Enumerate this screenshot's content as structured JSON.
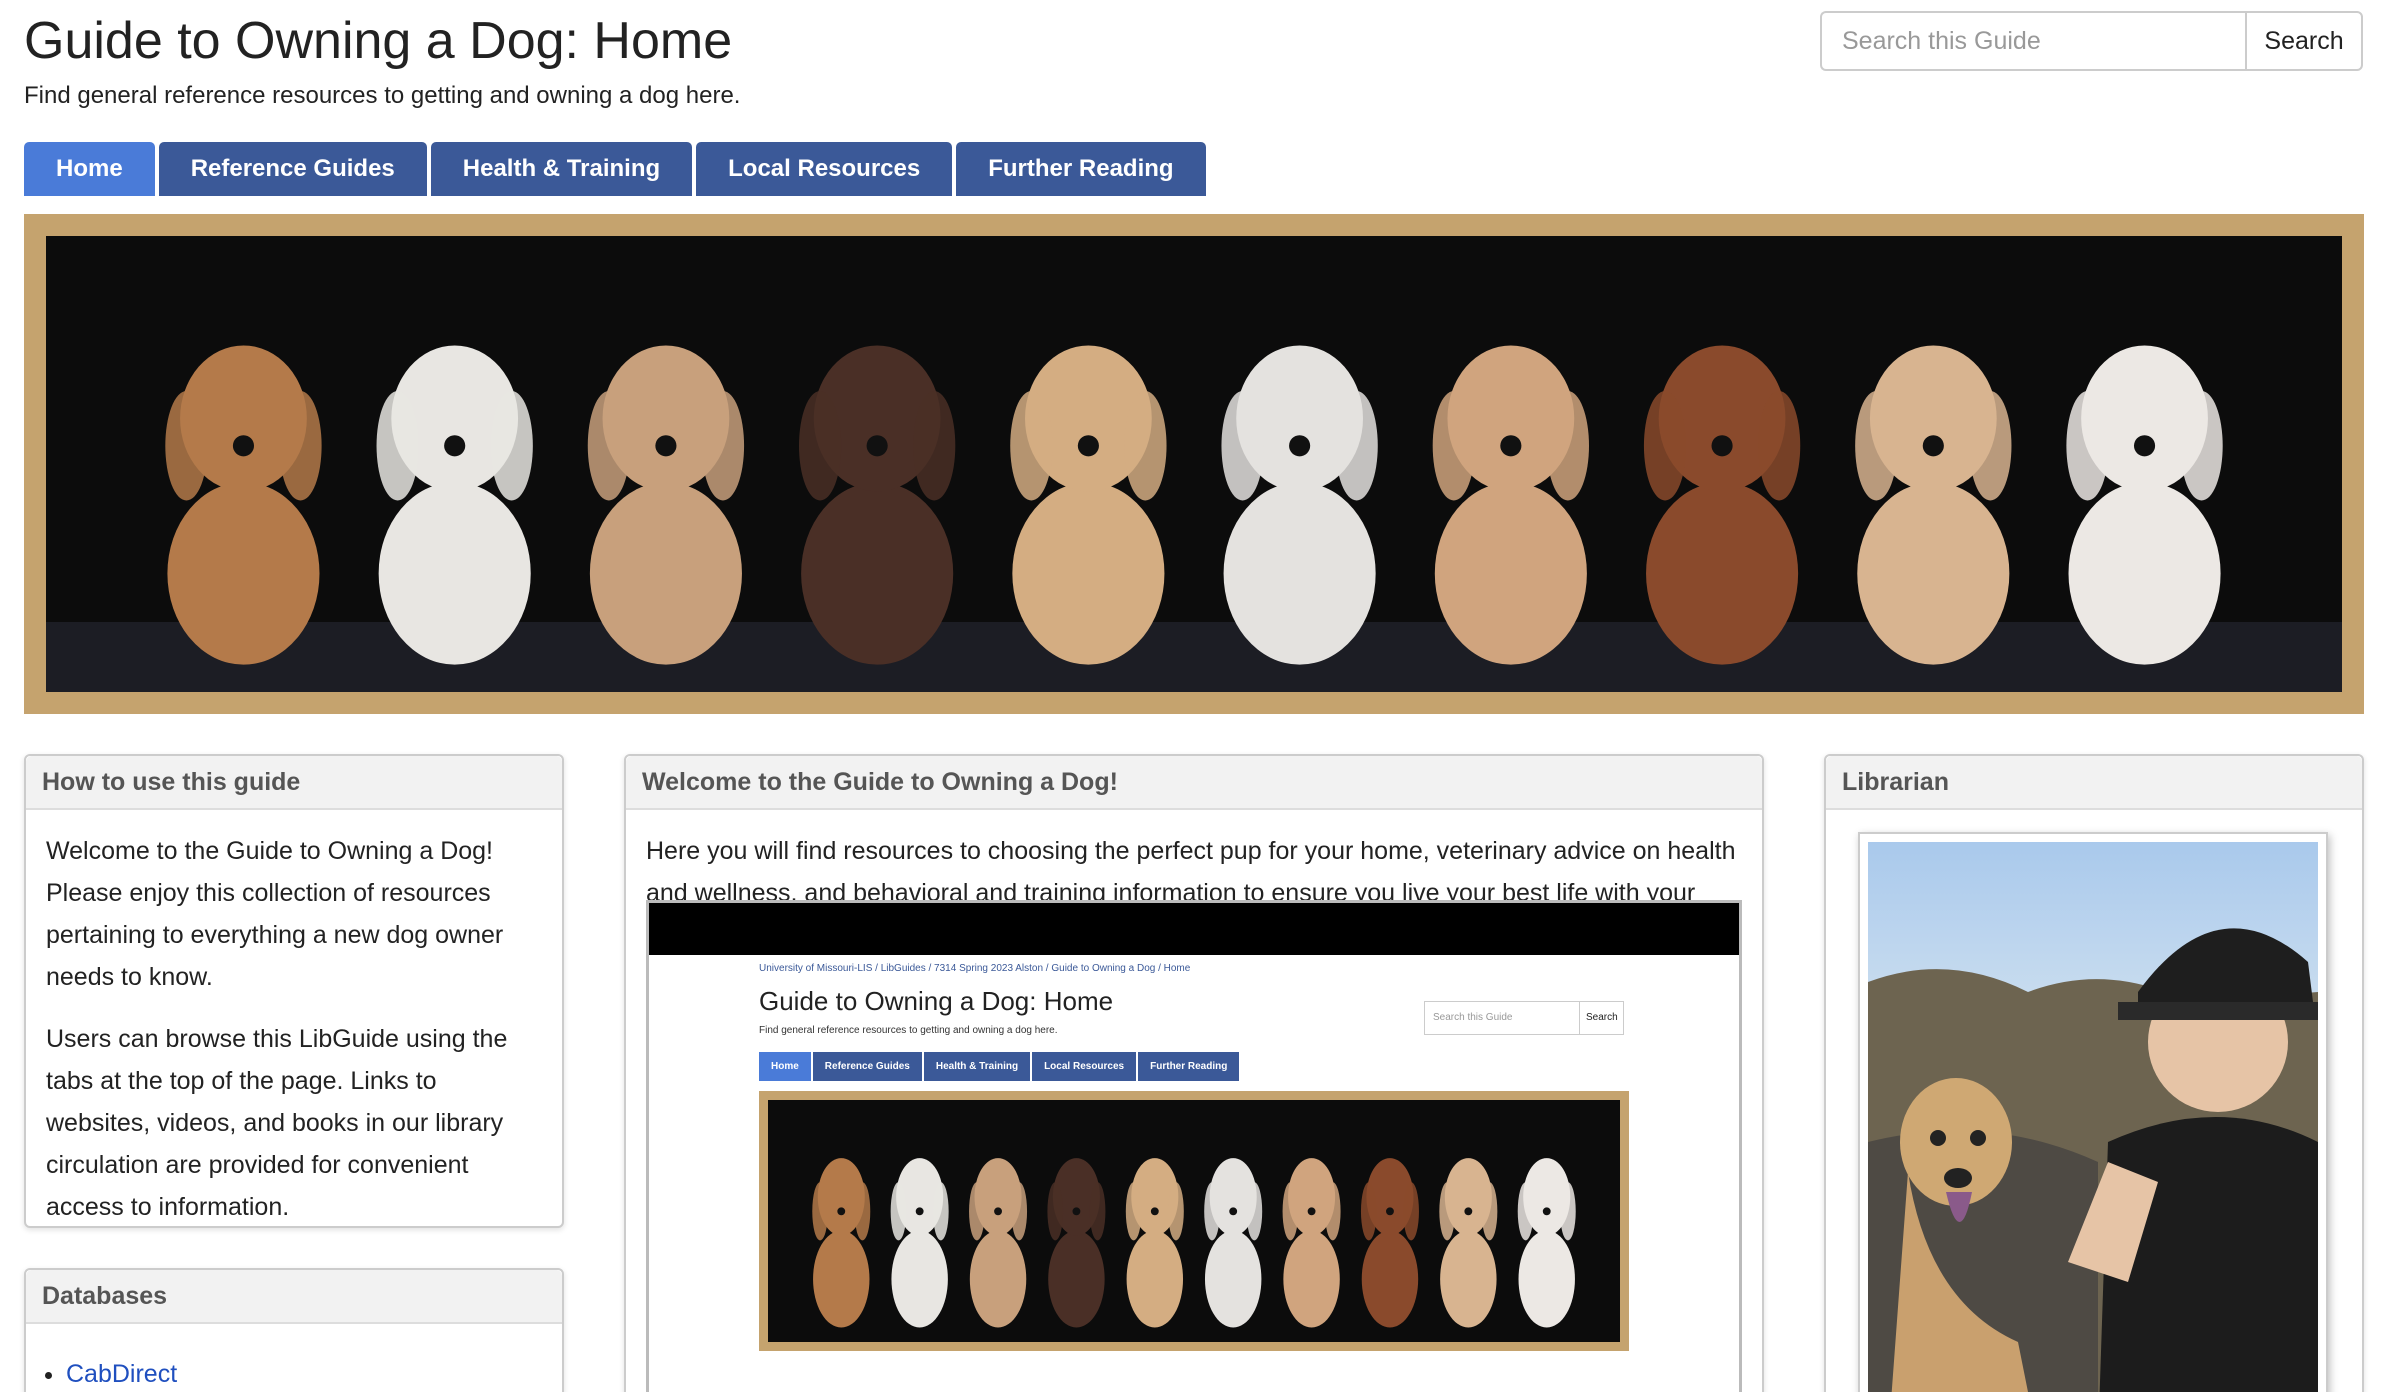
{
  "header": {
    "title": "Guide to Owning a Dog: Home",
    "description": "Find general reference resources to getting and owning a dog here."
  },
  "search": {
    "placeholder": "Search this Guide",
    "button_label": "Search"
  },
  "tabs": [
    {
      "label": "Home",
      "active": true
    },
    {
      "label": "Reference Guides",
      "active": false
    },
    {
      "label": "Health & Training",
      "active": false
    },
    {
      "label": "Local Resources",
      "active": false
    },
    {
      "label": "Further Reading",
      "active": false
    }
  ],
  "how_to_use": {
    "heading": "How to use this guide",
    "paragraph1": "Welcome to the Guide to Owning a Dog! Please enjoy this collection of resources pertaining to everything a new dog owner needs to know.",
    "paragraph2": "Users can browse this LibGuide using the tabs at the top of the page. Links to websites, videos, and books in our library circulation are provided for convenient access to information."
  },
  "databases": {
    "heading": "Databases",
    "items": [
      "CabDirect"
    ]
  },
  "welcome": {
    "heading": "Welcome to the Guide to Owning a Dog!",
    "text": "Here you will find resources to choosing the perfect pup for your home, veterinary advice on health and wellness, and behavioral and training information to ensure you live your best life with your best friend!"
  },
  "video_preview": {
    "breadcrumb": "University of Missouri-LIS  /  LibGuides  /  7314 Spring 2023 Alston  /  Guide to Owning a Dog  /  Home",
    "title": "Guide to Owning a Dog: Home",
    "description": "Find general reference resources to getting and owning a dog here.",
    "search_placeholder": "Search this Guide",
    "search_button": "Search",
    "tabs": [
      "Home",
      "Reference Guides",
      "Health & Training",
      "Local Resources",
      "Further Reading"
    ]
  },
  "librarian": {
    "heading": "Librarian"
  },
  "colors": {
    "tab_bg": "#3b5998",
    "tab_active_bg": "#4a7bd8",
    "banner_frame": "#c5a36e",
    "link": "#1f4fbf"
  },
  "puppies": [
    "#b47a4a",
    "#e8e6e2",
    "#c8a07c",
    "#4a2f26",
    "#d4ad82",
    "#e4e2df",
    "#d0a47e",
    "#8a4a2c",
    "#d8b490",
    "#ece8e4"
  ]
}
